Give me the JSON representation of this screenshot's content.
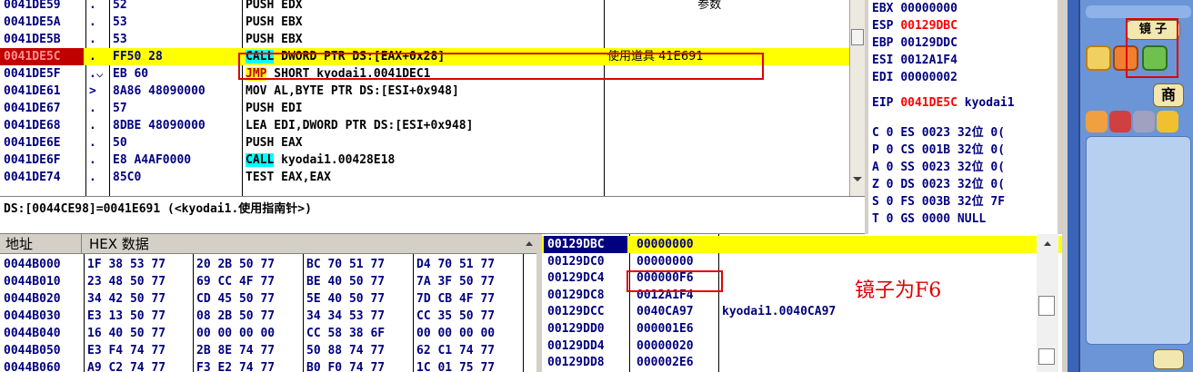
{
  "disasm": {
    "rows": [
      {
        "addr": "0041DE59",
        "mark": ".",
        "hex": "52",
        "op": "PUSH",
        "args": " EDX",
        "comment": "                        参数"
      },
      {
        "addr": "0041DE5A",
        "mark": ".",
        "hex": "53",
        "op": "PUSH",
        "args": " EBX",
        "comment": ""
      },
      {
        "addr": "0041DE5B",
        "mark": ".",
        "hex": "53",
        "op": "PUSH",
        "args": " EBX",
        "comment": ""
      },
      {
        "addr": "0041DE5C",
        "mark": ".",
        "hex": "FF50 28",
        "op": "CALL",
        "args": " DWORD PTR DS:[EAX+0x28]",
        "comment": "使用道具 41E691"
      },
      {
        "addr": "0041DE5F",
        "mark": ".⌵",
        "hex": "EB 60",
        "op": "JMP",
        "args": " SHORT kyodai1.0041DEC1",
        "comment": ""
      },
      {
        "addr": "0041DE61",
        "mark": ">",
        "hex": "8A86 48090000",
        "op": "MOV",
        "args": " AL,BYTE PTR DS:[ESI+0x948]",
        "comment": ""
      },
      {
        "addr": "0041DE67",
        "mark": ".",
        "hex": "57",
        "op": "PUSH",
        "args": " EDI",
        "comment": ""
      },
      {
        "addr": "0041DE68",
        "mark": ".",
        "hex": "8DBE 48090000",
        "op": "LEA",
        "args": " EDI,DWORD PTR DS:[ESI+0x948]",
        "comment": ""
      },
      {
        "addr": "0041DE6E",
        "mark": ".",
        "hex": "50",
        "op": "PUSH",
        "args": " EAX",
        "comment": ""
      },
      {
        "addr": "0041DE6F",
        "mark": ".",
        "hex": "E8 A4AF0000",
        "op": "CALL",
        "args": " kyodai1.00428E18",
        "comment": ""
      },
      {
        "addr": "0041DE74",
        "mark": ".",
        "hex": "85C0",
        "op": "TEST",
        "args": " EAX,EAX",
        "comment": ""
      }
    ],
    "info": "DS:[0044CE98]=0041E691 (<kyodai1.使用指南针>)"
  },
  "registers": {
    "rows": [
      {
        "name": "EBX",
        "val": "00000000",
        "sym": "",
        "red": false
      },
      {
        "name": "ESP",
        "val": "00129DBC",
        "sym": "",
        "red": true
      },
      {
        "name": "EBP",
        "val": "00129DDC",
        "sym": "",
        "red": false
      },
      {
        "name": "ESI",
        "val": "0012A1F4",
        "sym": "",
        "red": false
      },
      {
        "name": "EDI",
        "val": "00000002",
        "sym": "",
        "red": false
      },
      {
        "name": "EIP",
        "val": "0041DE5C",
        "sym": " kyodai1",
        "red": true
      },
      {
        "name": "C 0",
        "val": "ES 0023",
        "sym": " 32位 0(",
        "red": false
      },
      {
        "name": "P 0",
        "val": "CS 001B",
        "sym": " 32位 0(",
        "red": false
      },
      {
        "name": "A 0",
        "val": "SS 0023",
        "sym": " 32位 0(",
        "red": false
      },
      {
        "name": "Z 0",
        "val": "DS 0023",
        "sym": " 32位 0(",
        "red": false
      },
      {
        "name": "S 0",
        "val": "FS 003B",
        "sym": " 32位 7F",
        "red": false
      },
      {
        "name": "T 0",
        "val": "GS 0000",
        "sym": " NULL",
        "red": false
      }
    ]
  },
  "dump": {
    "header_addr": "地址",
    "header_hex": "HEX 数据",
    "rows": [
      {
        "addr": "0044B000",
        "g": [
          "1F 38 53 77",
          "20 2B 50 77",
          "BC 70 51 77",
          "D4 70 51 77"
        ]
      },
      {
        "addr": "0044B010",
        "g": [
          "23 48 50 77",
          "69 CC 4F 77",
          "BE 40 50 77",
          "7A 3F 50 77"
        ]
      },
      {
        "addr": "0044B020",
        "g": [
          "34 42 50 77",
          "CD 45 50 77",
          "5E 40 50 77",
          "7D CB 4F 77"
        ]
      },
      {
        "addr": "0044B030",
        "g": [
          "E3 13 50 77",
          "08 2B 50 77",
          "34 34 53 77",
          "CC 35 50 77"
        ]
      },
      {
        "addr": "0044B040",
        "g": [
          "16 40 50 77",
          "00 00 00 00",
          "CC 58 38 6F",
          "00 00 00 00"
        ]
      },
      {
        "addr": "0044B050",
        "g": [
          "E3 F4 74 77",
          "2B 8E 74 77",
          "50 88 74 77",
          "62 C1 74 77"
        ]
      },
      {
        "addr": "0044B060",
        "g": [
          "A9 C2 74 77",
          "F3 E2 74 77",
          "B0 F0 74 77",
          "1C 01 75 77"
        ]
      }
    ]
  },
  "stack": {
    "rows": [
      {
        "addr": "00129DBC",
        "val": "00000000",
        "com": ""
      },
      {
        "addr": "00129DC0",
        "val": "00000000",
        "com": ""
      },
      {
        "addr": "00129DC4",
        "val": "000000F6",
        "com": ""
      },
      {
        "addr": "00129DC8",
        "val": "0012A1F4",
        "com": ""
      },
      {
        "addr": "00129DCC",
        "val": "0040CA97",
        "com": "kyodai1.0040CA97"
      },
      {
        "addr": "00129DD0",
        "val": "000001E6",
        "com": ""
      },
      {
        "addr": "00129DD4",
        "val": "00000020",
        "com": ""
      },
      {
        "addr": "00129DD8",
        "val": "000002E6",
        "com": ""
      }
    ],
    "annotation": "镜子为F6"
  },
  "game": {
    "mirror_label": "镜 子",
    "shop_label": "商"
  },
  "colors": {
    "highlight": "#ffff00",
    "eip": "#c00000",
    "annotation": "#e00000"
  }
}
